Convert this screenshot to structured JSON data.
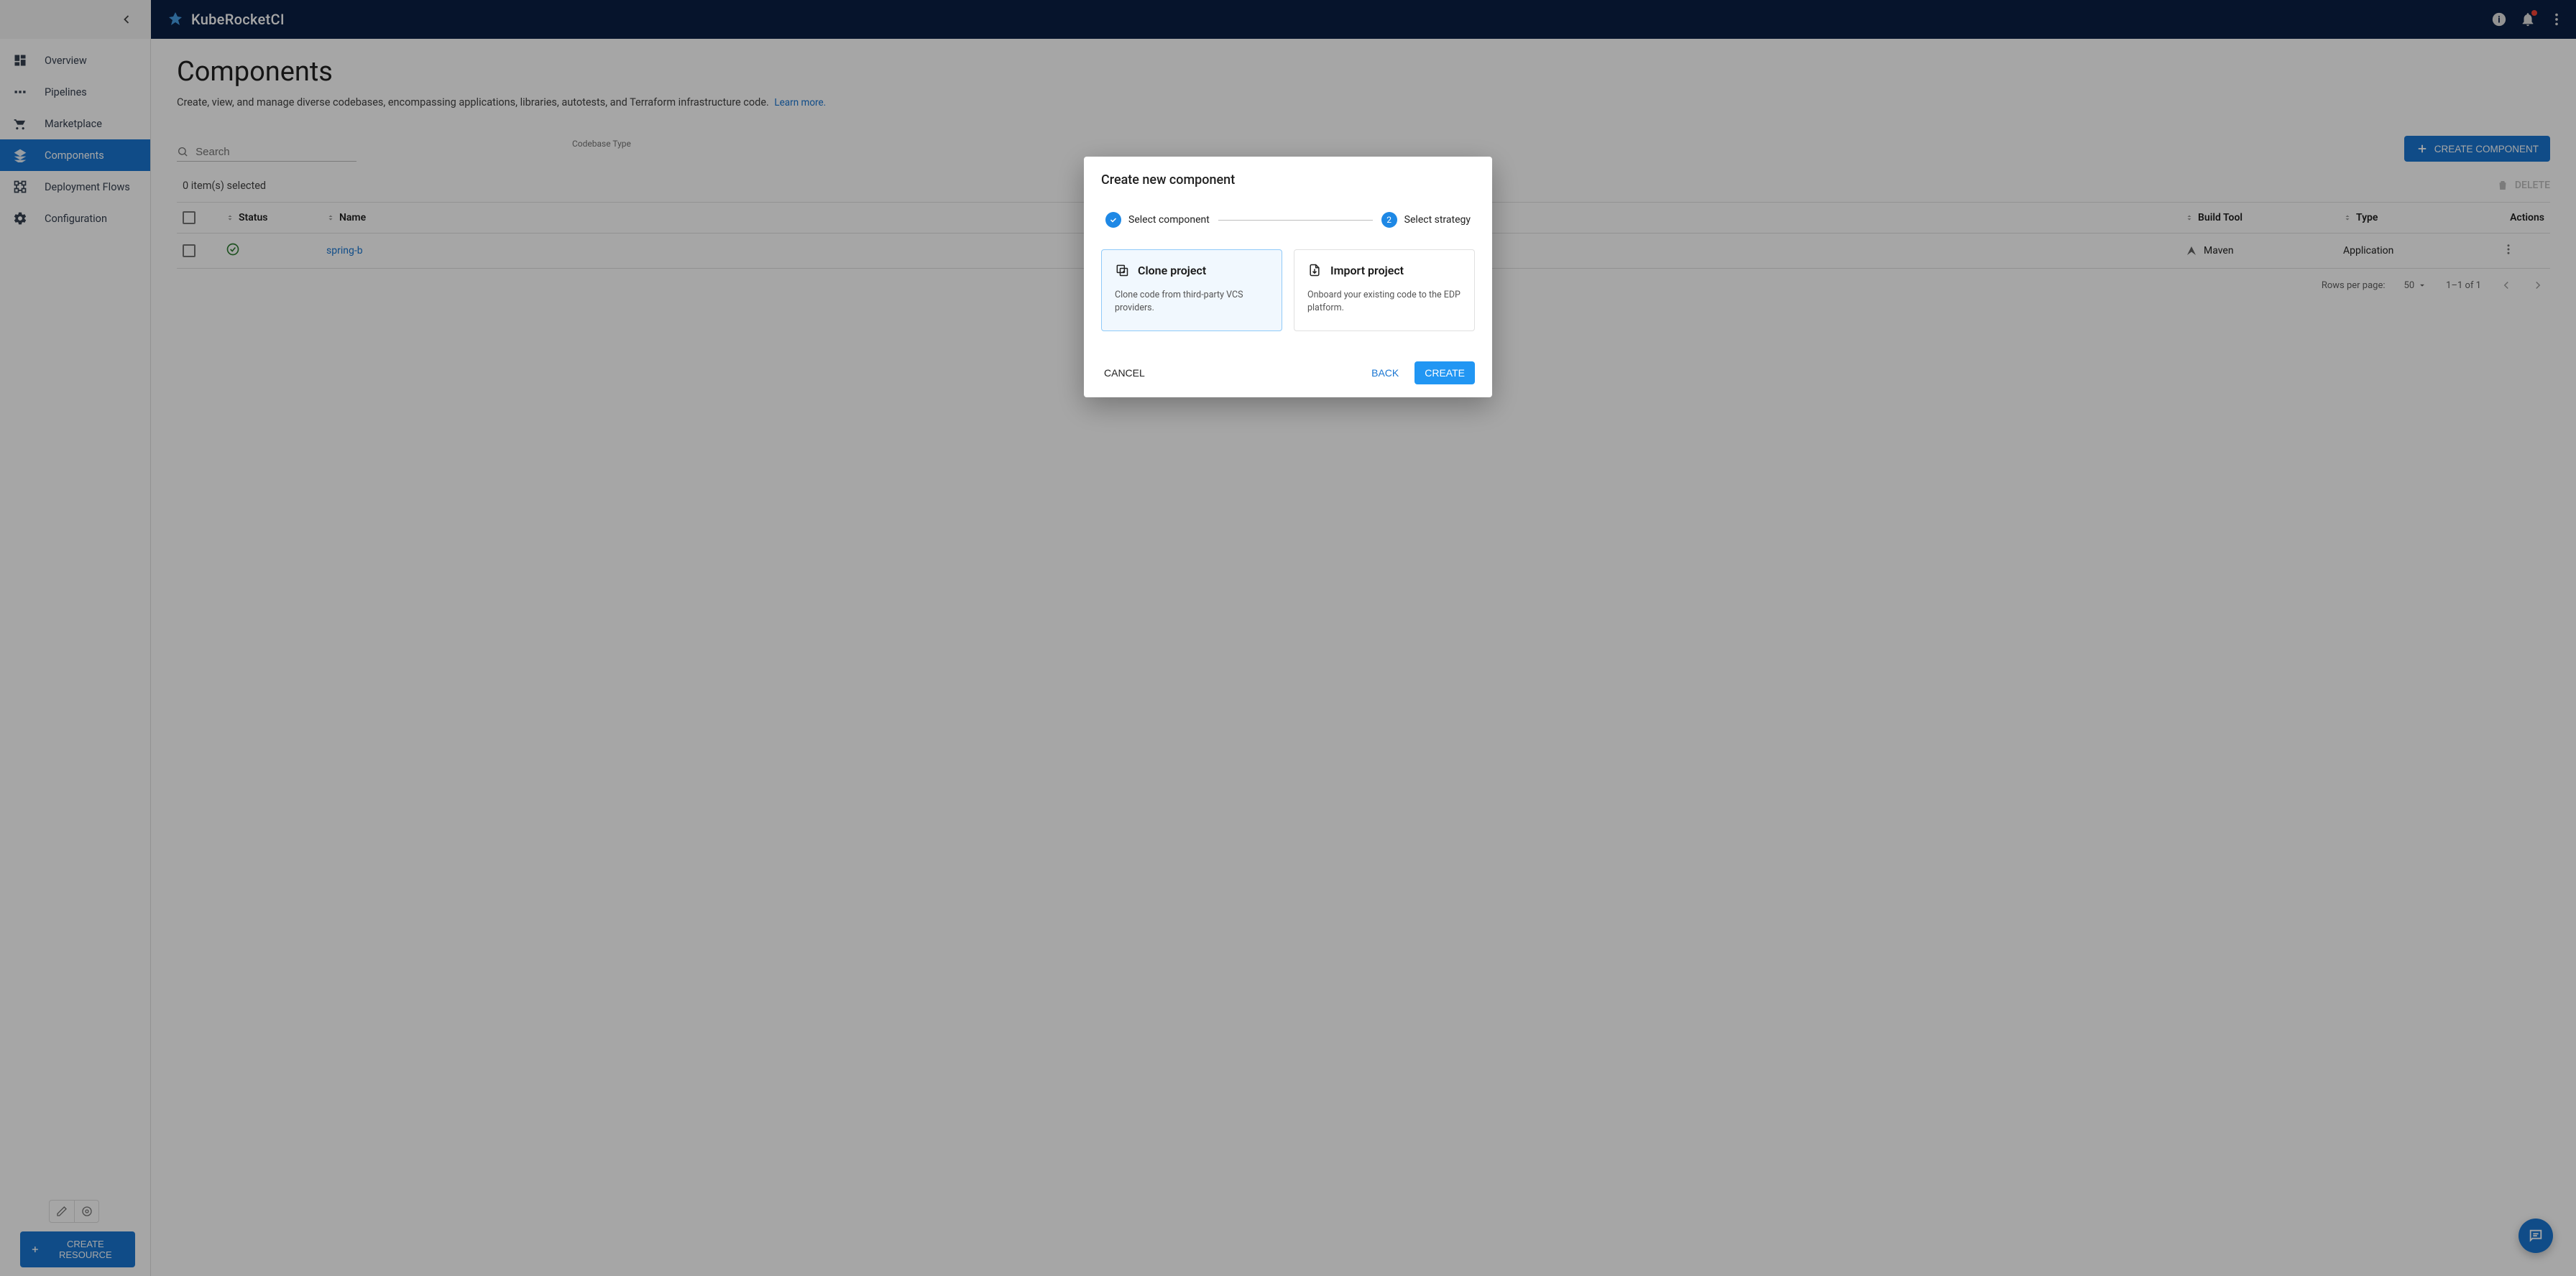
{
  "header": {
    "brand": "KubeRocketCI"
  },
  "sidebar": {
    "items": [
      {
        "label": "Overview"
      },
      {
        "label": "Pipelines"
      },
      {
        "label": "Marketplace"
      },
      {
        "label": "Components"
      },
      {
        "label": "Deployment Flows"
      },
      {
        "label": "Configuration"
      }
    ],
    "create_resource": "CREATE RESOURCE"
  },
  "page": {
    "title": "Components",
    "description": "Create, view, and manage diverse codebases, encompassing applications, libraries, autotests, and Terraform infrastructure code.",
    "learn_more": "Learn more.",
    "codebase_type_label": "Codebase Type",
    "search_placeholder": "Search",
    "create_component": "CREATE COMPONENT",
    "selected_text": "0 item(s) selected",
    "delete": "DELETE"
  },
  "table": {
    "headers": {
      "status": "Status",
      "name": "Name",
      "build_tool": "Build Tool",
      "type": "Type",
      "actions": "Actions"
    },
    "rows": [
      {
        "name": "spring-b",
        "build_tool": "Maven",
        "type": "Application"
      }
    ]
  },
  "pagination": {
    "rows_label": "Rows per page:",
    "rows_value": "50",
    "range": "1–1 of 1"
  },
  "modal": {
    "title": "Create new component",
    "step1": "Select component",
    "step2": "Select strategy",
    "step2_num": "2",
    "card_clone_title": "Clone project",
    "card_clone_desc": "Clone code from third-party VCS providers.",
    "card_import_title": "Import project",
    "card_import_desc": "Onboard your existing code to the EDP platform.",
    "cancel": "CANCEL",
    "back": "BACK",
    "create": "CREATE"
  }
}
